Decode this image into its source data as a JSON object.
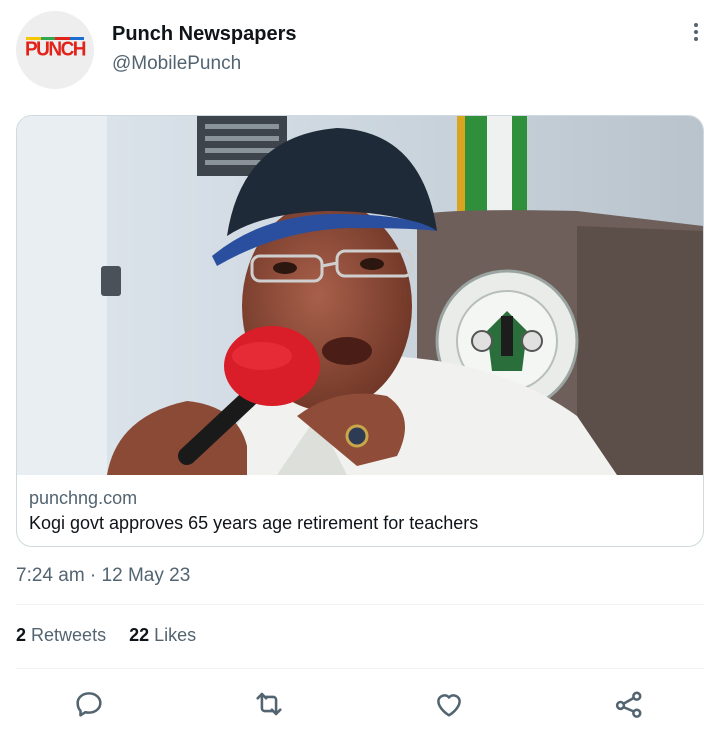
{
  "account": {
    "avatar_logo_text": "PUNCH",
    "display_name": "Punch Newspapers",
    "handle": "@MobilePunch"
  },
  "link_card": {
    "domain": "punchng.com",
    "headline": "Kogi govt approves 65 years age retirement for teachers"
  },
  "tweet": {
    "timestamp": "7:24 am · 12 May 23"
  },
  "stats": {
    "retweets_count": "2",
    "retweets_label": "Retweets",
    "likes_count": "22",
    "likes_label": "Likes"
  },
  "colors": {
    "brand_red": "#e2231a",
    "secondary_text": "#536471",
    "primary_text": "#0f1419",
    "border": "#cfd9de"
  },
  "icons": [
    "more-vertical-icon",
    "reply-icon",
    "retweet-icon",
    "like-icon",
    "share-icon"
  ]
}
